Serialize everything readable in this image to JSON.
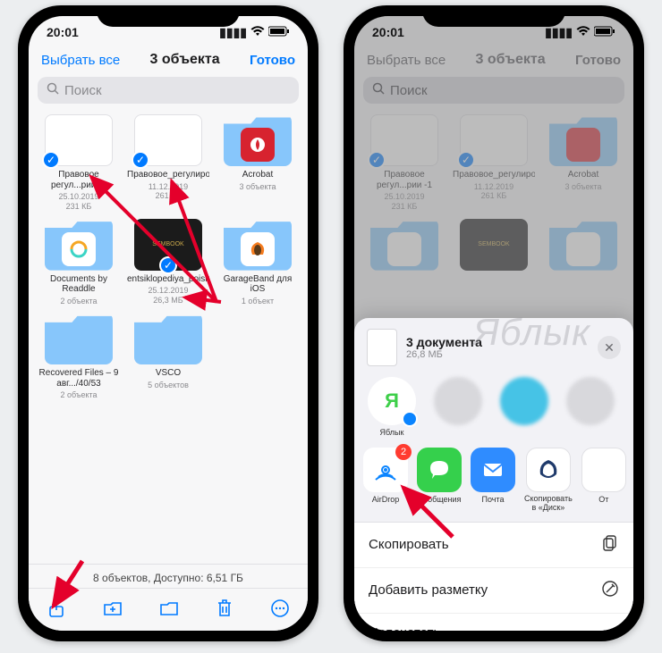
{
  "status": {
    "time": "20:01",
    "signal": "▮▮▮▮",
    "wifi": "wifi",
    "battery": "batt"
  },
  "left": {
    "nav": {
      "select_all": "Выбрать все",
      "title": "3 объекта",
      "done": "Готово"
    },
    "search_placeholder": "Поиск",
    "items": [
      {
        "name": "Правовое регул...рии -1",
        "date": "25.10.2019",
        "size": "231 КБ",
        "type": "doc",
        "selected": true
      },
      {
        "name": "Правовое_регулиро...еской",
        "date": "11.12.2019",
        "size": "261 КБ",
        "type": "doc",
        "selected": true
      },
      {
        "name": "Acrobat",
        "meta": "3 объекта",
        "type": "folder",
        "icon_bg": "#d7232f"
      },
      {
        "name": "Documents by Readdle",
        "meta": "2 объекта",
        "type": "folder",
        "icon_bg": "#ffffff"
      },
      {
        "name": "entsiklopediya_poisko...heniya",
        "date": "25.12.2019",
        "size": "26,3 МБ",
        "type": "book",
        "selected": true
      },
      {
        "name": "GarageBand для iOS",
        "meta": "1 объект",
        "type": "folder",
        "icon_bg": "#ffffff"
      },
      {
        "name": "Recovered Files – 9 авг.../40/53",
        "meta": "2 объекта",
        "type": "folder"
      },
      {
        "name": "VSCO",
        "meta": "5 объектов",
        "type": "folder"
      }
    ],
    "footer": "8 объектов, Доступно: 6,51 ГБ"
  },
  "right": {
    "nav": {
      "select_all": "Выбрать все",
      "title": "3 объекта",
      "done": "Готово"
    },
    "search_placeholder": "Поиск",
    "sheet": {
      "title": "3 документа",
      "subtitle": "26,8 МБ",
      "contacts": [
        {
          "label": "Яблык",
          "color": "#3ecf4a",
          "letter": "Я"
        },
        {
          "label": "",
          "color": "#b9b9bd"
        },
        {
          "label": "",
          "color": "#46c3e6"
        },
        {
          "label": "",
          "color": "#b9b9bd"
        }
      ],
      "apps": [
        {
          "label": "AirDrop",
          "color": "#f7f7f8",
          "icon": "airdrop",
          "badge": "2"
        },
        {
          "label": "Сообщения",
          "color": "#35d04c",
          "icon": "msg"
        },
        {
          "label": "Почта",
          "color": "#2f8cff",
          "icon": "mail"
        },
        {
          "label": "Скопировать в «Диск»",
          "color": "#ffffff",
          "icon": "disk"
        },
        {
          "label": "От",
          "color": "#ffffff",
          "icon": ""
        }
      ],
      "actions": [
        {
          "label": "Скопировать",
          "icon": "copy"
        },
        {
          "label": "Добавить разметку",
          "icon": "markup"
        },
        {
          "label": "Напечатать",
          "icon": "print"
        }
      ]
    }
  }
}
